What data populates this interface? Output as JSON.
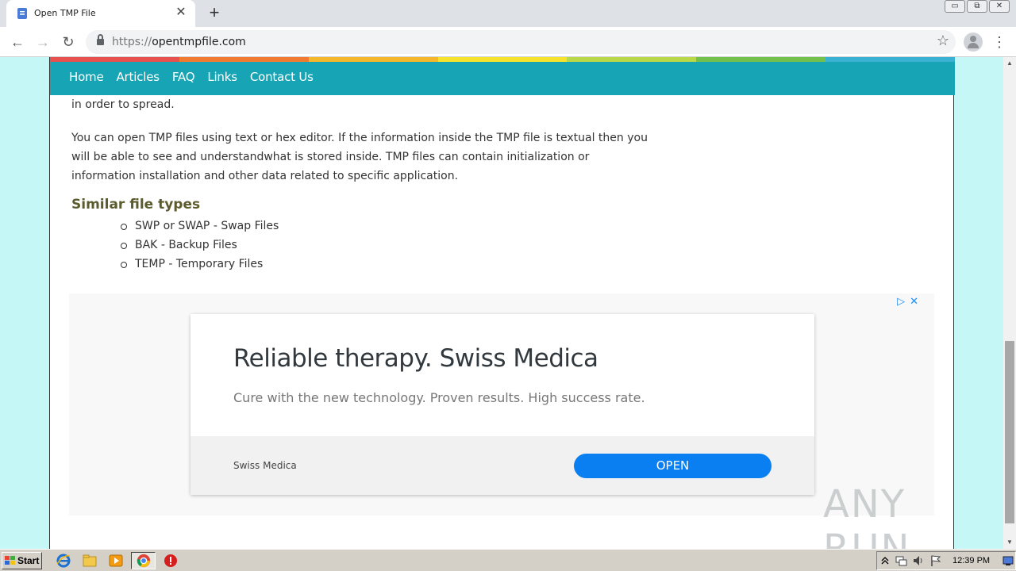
{
  "browser": {
    "tab_title": "Open TMP File",
    "tab_close": "✕",
    "new_tab": "+",
    "url_protocol": "https://",
    "url_host": "opentmpfile.com",
    "back": "←",
    "forward": "→",
    "reload": "↻",
    "bookmark": "☆",
    "menu": "⋮",
    "window_controls": [
      "▭",
      "⧉",
      "✕"
    ]
  },
  "site": {
    "nav": [
      "Home",
      "Articles",
      "FAQ",
      "Links",
      "Contact Us"
    ],
    "rainbow_colors": [
      "#e9514f",
      "#f07a2f",
      "#f4b62a",
      "#f6e12b",
      "#b9d849",
      "#74c04c",
      "#3ab1d3"
    ]
  },
  "content": {
    "cut_paragraph": "in order to spread.",
    "paragraph": "You can open TMP files using text or hex editor. If the information inside the TMP file is textual then you will be able to see and understandwhat is stored inside. TMP files can contain initialization or information installation and other data related to specific application.",
    "similar_heading": "Similar file types",
    "similar_types": [
      "SWP or SWAP - Swap Files",
      "BAK - Backup Files",
      "TEMP - Temporary Files"
    ]
  },
  "ad": {
    "choices_icon": "▷",
    "close_icon": "✕",
    "title": "Reliable therapy. Swiss Medica",
    "description": "Cure with the new technology. Proven results. High success rate.",
    "advertiser": "Swiss Medica",
    "cta": "OPEN"
  },
  "watermark": "ANY RUN",
  "taskbar": {
    "start": "Start",
    "time": "12:39 PM"
  }
}
